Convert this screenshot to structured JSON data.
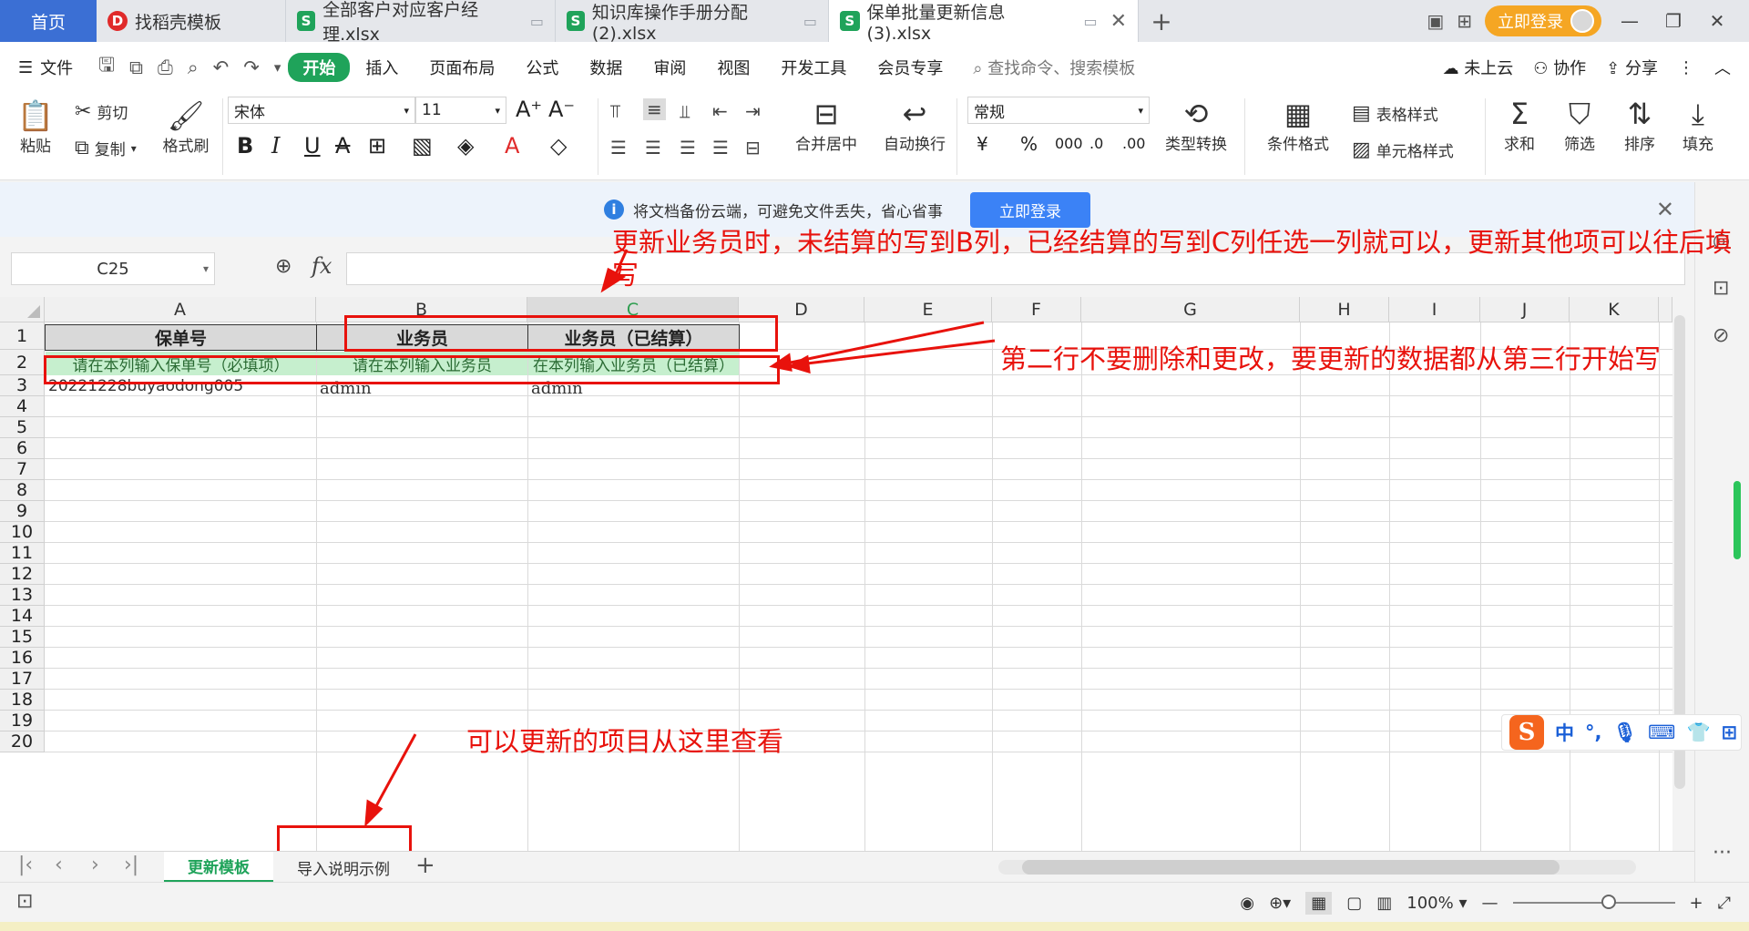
{
  "tabs": {
    "home": "首页",
    "items": [
      {
        "label": "找稻壳模板",
        "icon": "docer-icon",
        "active": false
      },
      {
        "label": "全部客户对应客户经理.xlsx",
        "icon": "spreadsheet-icon",
        "active": false
      },
      {
        "label": "知识库操作手册分配(2).xlsx",
        "icon": "spreadsheet-icon",
        "active": false
      },
      {
        "label": "保单批量更新信息 (3).xlsx",
        "icon": "spreadsheet-icon",
        "active": true
      }
    ],
    "login": "立即登录"
  },
  "menu": {
    "file": "文件",
    "items": [
      "开始",
      "插入",
      "页面布局",
      "公式",
      "数据",
      "审阅",
      "视图",
      "开发工具",
      "会员专享"
    ],
    "active": "开始",
    "search": "查找命令、搜索模板",
    "cloud": "未上云",
    "collab": "协作",
    "share": "分享"
  },
  "ribbon": {
    "paste": "粘贴",
    "cut": "剪切",
    "copy": "复制",
    "format_painter": "格式刷",
    "font_name": "宋体",
    "font_size": "11",
    "merge_center": "合并居中",
    "wrap_text": "自动换行",
    "number_format": "常规",
    "type_convert": "类型转换",
    "cond_format": "条件格式",
    "table_style": "表格样式",
    "cell_style": "单元格样式",
    "sum": "求和",
    "filter": "筛选",
    "sort": "排序",
    "fill": "填充"
  },
  "banner": {
    "text": "将文档备份云端，可避免文件丢失，省心省事",
    "button": "立即登录"
  },
  "formula_bar": {
    "cell_ref": "C25",
    "fx": "fx",
    "content": ""
  },
  "sheet": {
    "columns": [
      "A",
      "B",
      "C",
      "D",
      "E",
      "F",
      "G",
      "H",
      "I",
      "J",
      "K"
    ],
    "selected_column": "C",
    "rows": [
      "1",
      "2",
      "3",
      "4",
      "5",
      "6",
      "7",
      "8",
      "9",
      "10",
      "11",
      "12",
      "13",
      "14",
      "15",
      "16",
      "17",
      "18",
      "19",
      "20"
    ],
    "row1": {
      "A": "保单号",
      "B": "业务员",
      "C": "业务员（已结算）"
    },
    "row2": {
      "A": "请在本列输入保单号（必填项）",
      "B": "请在本列输入业务员",
      "C": "在本列输入业务员（已结算）"
    },
    "row3": {
      "A": "20221228buyaodong005",
      "B": "admin",
      "C": "admin"
    }
  },
  "annotations": {
    "top": "更新业务员时，未结算的写到B列，已经结算的写到C列任选一列就可以，更新其他项可以往后填写",
    "right": "第二行不要删除和更改，要更新的数据都从第三行开始写",
    "bottom": "可以更新的项目从这里查看",
    "color": "#e8120c"
  },
  "sheet_tabs": {
    "items": [
      "更新模板",
      "导入说明示例"
    ],
    "active": "更新模板"
  },
  "status": {
    "zoom": "100%"
  },
  "ime": {
    "logo": "S",
    "mode": "中"
  },
  "colors": {
    "accent": "#1fa35a",
    "home_tab": "#3b6fd4",
    "login": "#f5a623",
    "hint_fill": "#c6efce",
    "header_fill": "#d9d9d9"
  }
}
